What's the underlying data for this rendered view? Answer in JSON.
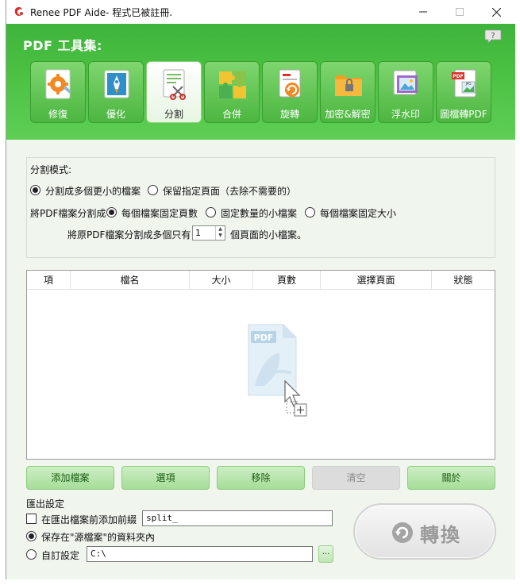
{
  "window": {
    "title": "Renee PDF Aide- 程式已被註冊."
  },
  "header": {
    "title": "PDF 工具集:",
    "tools": [
      {
        "label": "修復"
      },
      {
        "label": "優化"
      },
      {
        "label": "分割"
      },
      {
        "label": "合併"
      },
      {
        "label": "旋轉"
      },
      {
        "label": "加密&解密"
      },
      {
        "label": "浮水印"
      },
      {
        "label": "圖檔轉PDF"
      }
    ],
    "active_tool": "分割"
  },
  "split_mode": {
    "section_label": "分割模式:",
    "option_smaller": "分割成多個更小的檔案",
    "option_keep": "保留指定頁面（去除不需要的）",
    "split_into_label": "將PDF檔案分割成",
    "option_fixed_pages": "每個檔案固定頁數",
    "option_fixed_count": "固定數量的小檔案",
    "option_fixed_size": "每個檔案固定大小",
    "pages_prefix": "將原PDF檔案分割成多個只有",
    "pages_value": "1",
    "pages_suffix": "個頁面的小檔案。"
  },
  "file_table": {
    "columns": [
      "項",
      "檔名",
      "大小",
      "頁數",
      "選擇頁面",
      "狀態"
    ]
  },
  "actions": {
    "add": "添加檔案",
    "options": "選項",
    "remove": "移除",
    "clear": "清空",
    "about": "關於"
  },
  "export": {
    "section_label": "匯出設定",
    "prefix_label": "在匯出檔案前添加前綴",
    "prefix_value": "split_",
    "save_source_label": "保存在\"源檔案\"的資料夾內",
    "custom_label": "自訂設定",
    "custom_path": "C:\\",
    "browse_label": "..."
  },
  "convert": {
    "label": "轉換"
  },
  "colors": {
    "header_green": "#4cc244",
    "button_green": "#b6e4a9",
    "convert_gray": "#e8e8e8"
  }
}
